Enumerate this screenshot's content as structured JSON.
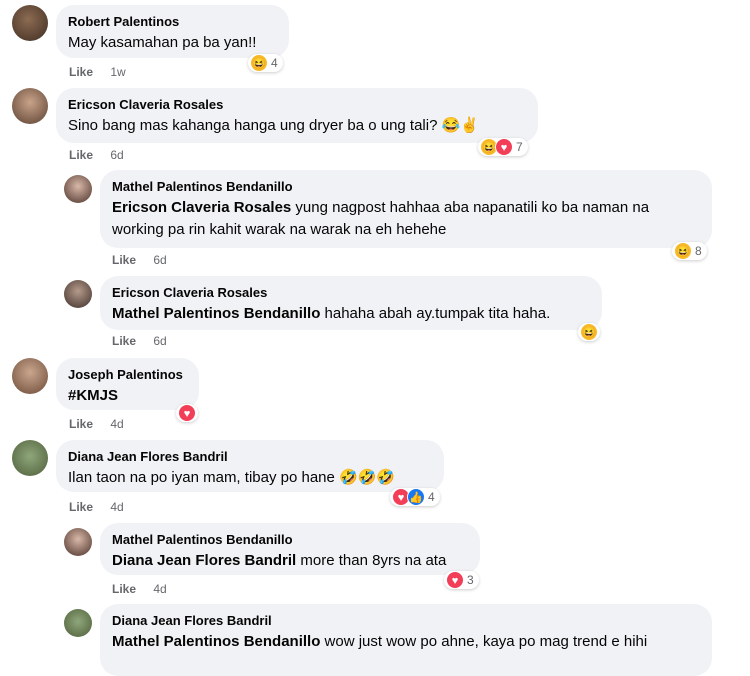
{
  "comments": [
    {
      "author": "Robert Palentinos",
      "text": "May kasamahan pa ba yan!!",
      "like": "Like",
      "time": "1w",
      "count": "4"
    },
    {
      "author": "Ericson Claveria Rosales",
      "text": "Sino bang mas kahanga hanga ung dryer ba o ung tali? 😂✌️",
      "like": "Like",
      "time": "6d",
      "count": "7"
    },
    {
      "author": "Mathel Palentinos Bendanillo",
      "mention": "Ericson Claveria Rosales",
      "text": " yung nagpost hahhaa aba napanatili ko ba naman na working pa rin kahit warak na warak na eh hehehe",
      "like": "Like",
      "time": "6d",
      "count": "8"
    },
    {
      "author": "Ericson Claveria Rosales",
      "mention": "Mathel Palentinos Bendanillo",
      "text": " hahaha abah ay.tumpak tita haha.",
      "like": "Like",
      "time": "6d"
    },
    {
      "author": "Joseph Palentinos",
      "text": "#KMJS",
      "like": "Like",
      "time": "4d"
    },
    {
      "author": "Diana Jean Flores Bandril",
      "text": "Ilan taon na po iyan mam, tibay po hane 🤣🤣🤣",
      "like": "Like",
      "time": "4d",
      "count": "4"
    },
    {
      "author": "Mathel Palentinos Bendanillo",
      "mention": "Diana Jean Flores Bandril",
      "text": " more than 8yrs na ata",
      "like": "Like",
      "time": "4d",
      "count": "3"
    },
    {
      "author": "Diana Jean Flores Bandril",
      "mention": "Mathel Palentinos Bendanillo",
      "text": " wow just wow po ahne, kaya po mag trend e hihi"
    }
  ],
  "reaction_icons": {
    "haha": "haha-icon",
    "love": "love-icon",
    "like": "like-icon"
  }
}
